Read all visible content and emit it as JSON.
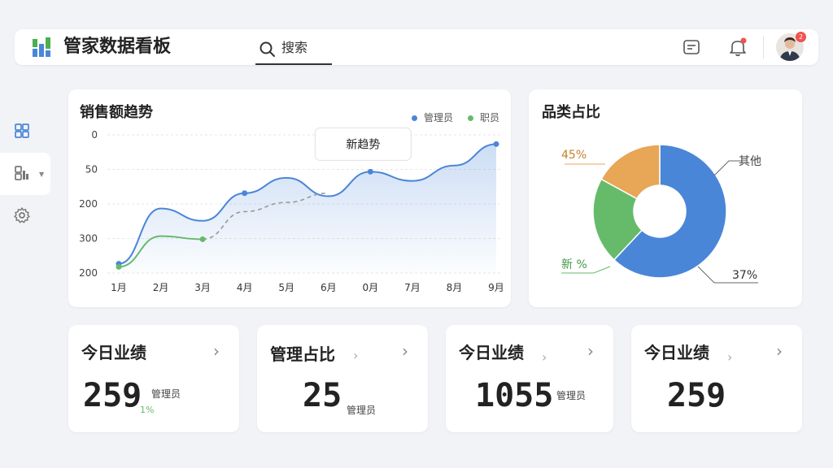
{
  "header": {
    "app_title": "管家数据看板",
    "search_label": "搜索"
  },
  "notifications": {
    "avatar_badge": "2"
  },
  "colors": {
    "blue": "#4a86d8",
    "green": "#66bb6a",
    "orange": "#e8a657",
    "bg": "#f2f3f6"
  },
  "sales_chart": {
    "title": "销售额趋势",
    "legend": [
      "管理员",
      "职员"
    ]
  },
  "chart_data": [
    {
      "type": "line",
      "title": "销售额趋势",
      "categories": [
        "1月",
        "2月",
        "3月",
        "4月",
        "5月",
        "6月",
        "0月",
        "7月",
        "8月",
        "9月"
      ],
      "y_ticks": [
        "0",
        "50",
        "200",
        "300",
        "200"
      ],
      "series": [
        {
          "name": "管理员",
          "values": [
            30,
            210,
            170,
            260,
            310,
            250,
            330,
            300,
            350,
            420
          ]
        },
        {
          "name": "职员",
          "values": [
            20,
            120,
            110,
            200,
            230,
            260,
            null,
            null,
            null,
            null
          ]
        }
      ],
      "tooltip": "新趋势",
      "grid": true,
      "legend_position": "top-right"
    },
    {
      "type": "pie",
      "title": "品类占比",
      "slices": [
        {
          "label": "37%",
          "value": 62,
          "color": "#4a86d8"
        },
        {
          "label": "新 %",
          "value": 21,
          "color": "#66bb6a"
        },
        {
          "label": "45%",
          "value": 17,
          "color": "#e8a657"
        }
      ],
      "outer_label": "其他"
    }
  ],
  "category_chart": {
    "title": "品类占比",
    "label_tl": "45%",
    "label_tr": "其他",
    "label_bl": "新 %",
    "label_br": "37%"
  },
  "stats": [
    {
      "title": "今日业绩",
      "value": "259",
      "sub": "管理员",
      "delta": "1%"
    },
    {
      "title": "管理占比",
      "value": "25",
      "sub": "管理员"
    },
    {
      "title": "今日业绩",
      "value": "1055",
      "sub": "管理员"
    },
    {
      "title": "今日业绩",
      "value": "259"
    }
  ]
}
